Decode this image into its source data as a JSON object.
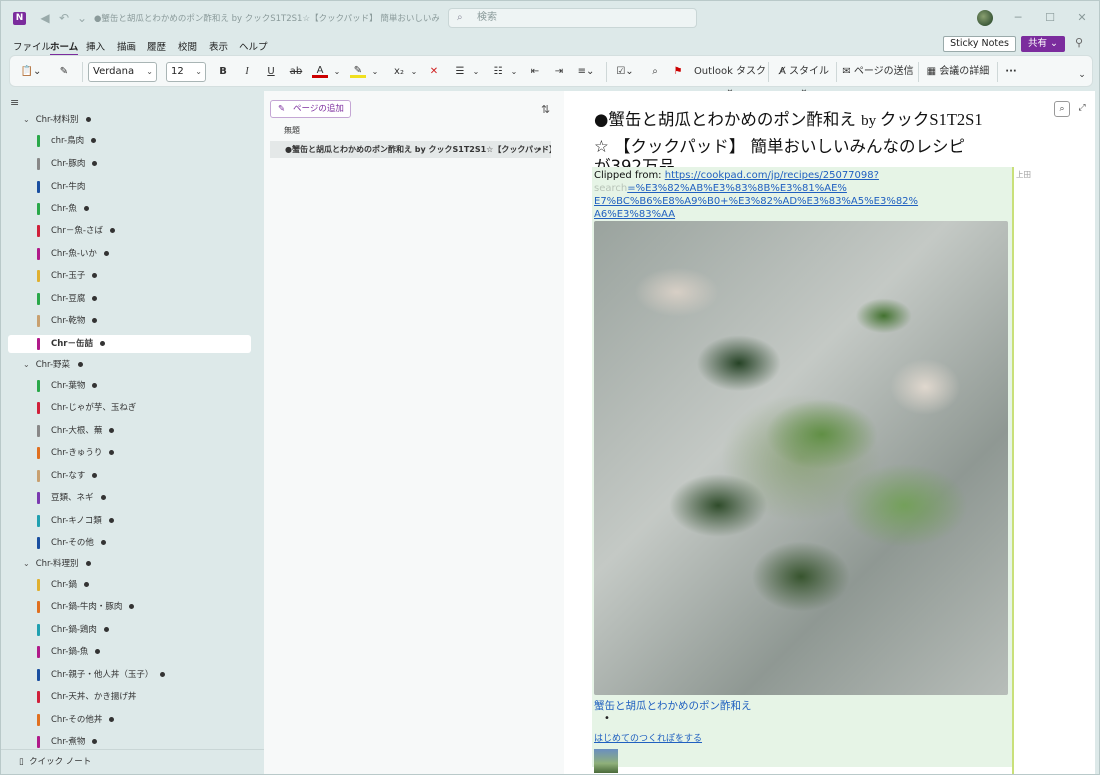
{
  "window": {
    "title": "●蟹缶と胡瓜とわかめのポン酢和え by クックS1T2S1☆【クックパッド】 簡単おいしいみんなの - One...",
    "search_placeholder": "検索"
  },
  "menu": [
    "ファイル",
    "ホーム",
    "挿入",
    "描画",
    "履歴",
    "校閲",
    "表示",
    "ヘルプ"
  ],
  "active_menu": "ホーム",
  "top_right": {
    "sticky_notes": "Sticky Notes",
    "share": "共有"
  },
  "ribbon": {
    "font": "Verdana",
    "size": "12",
    "bold": "B",
    "italic": "I",
    "underline": "U",
    "strike": "ab",
    "font_color": "A",
    "subscript": "x₂",
    "outlook_tasks": "Outlook タスク",
    "styles": "スタイル",
    "send_page": "ページの送信",
    "meeting": "会議の詳細",
    "more": "···"
  },
  "sidebar": {
    "sections": [
      {
        "label": "Chr-材料別"
      },
      {
        "label": "Chr-野菜"
      },
      {
        "label": "Chr-料理別"
      }
    ],
    "pages": [
      {
        "label": "chr-鳥肉",
        "color": "#2aa84a",
        "dot": true
      },
      {
        "label": "Chr-豚肉",
        "color": "#888888",
        "dot": true
      },
      {
        "label": "Chr-牛肉",
        "color": "#1a4fa0",
        "dot": false
      },
      {
        "label": "Chr-魚",
        "color": "#2aa84a",
        "dot": true
      },
      {
        "label": "Chr－魚-さば",
        "color": "#d0203a",
        "dot": true
      },
      {
        "label": "Chr-魚-いか",
        "color": "#b01a8a",
        "dot": true
      },
      {
        "label": "Chr-玉子",
        "color": "#e0b030",
        "dot": true
      },
      {
        "label": "Chr-豆腐",
        "color": "#2aa84a",
        "dot": true
      },
      {
        "label": "Chr-乾物",
        "color": "#c8a070",
        "dot": true
      },
      {
        "label": "Chr－缶詰",
        "color": "#b01a8a",
        "dot": true
      },
      {
        "label": "Chr-葉物",
        "color": "#2aa84a",
        "dot": true
      },
      {
        "label": "Chr-じゃが芋、玉ねぎ",
        "color": "#d0203a",
        "dot": false
      },
      {
        "label": "Chr-大根、蕪",
        "color": "#888888",
        "dot": true
      },
      {
        "label": "Chr-きゅうり",
        "color": "#e07020",
        "dot": true
      },
      {
        "label": "Chr-なす",
        "color": "#c8a070",
        "dot": true
      },
      {
        "label": "豆類、ネギ",
        "color": "#7a3ab0",
        "dot": true
      },
      {
        "label": "Chr-キノコ類",
        "color": "#20a0b0",
        "dot": true
      },
      {
        "label": "Chr-その他",
        "color": "#1a4fa0",
        "dot": true
      },
      {
        "label": "Chr-鍋",
        "color": "#e0b030",
        "dot": true
      },
      {
        "label": "Chr-鍋-牛肉・豚肉",
        "color": "#e07020",
        "dot": true
      },
      {
        "label": "Chr-鍋-鶏肉",
        "color": "#20a0b0",
        "dot": true
      },
      {
        "label": "Chr-鍋-魚",
        "color": "#b01a8a",
        "dot": true
      },
      {
        "label": "Chr-親子・他人丼（玉子）",
        "color": "#1a4fa0",
        "dot": true
      },
      {
        "label": "Chr-天丼、かき揚げ丼",
        "color": "#d0203a",
        "dot": false
      },
      {
        "label": "Chr-その他丼",
        "color": "#e07020",
        "dot": true
      },
      {
        "label": "Chr-煮物",
        "color": "#b01a8a",
        "dot": true
      }
    ],
    "selected": "Chr－缶詰",
    "quick_note": "クイック ノート"
  },
  "pages_pane": {
    "add_page": "ページの追加",
    "items": [
      {
        "label": "無題"
      },
      {
        "label": "●蟹缶と胡瓜とわかめのポン酢和え by クックS1T2S1☆【クックパッド】..."
      }
    ]
  },
  "content": {
    "title_a": "●蟹缶と胡瓜とわかめのポン酢和え ",
    "title_by": "by ",
    "title_b": "クック",
    "title_en": "S1T2S1",
    "title_line2": "☆ 【クックパッド】 簡単おいしいみんなのレシピ",
    "title_line3": "が392万品",
    "author": "上田",
    "clipped_label": "Clipped from: ",
    "url_a": "https://cookpad.com/jp/recipes/25077098?",
    "url_b": "=%E3%82%AB%E3%83%8B%E3%81%AE%",
    "url_c": "E7%BC%B6%E8%A9%B0+%E3%82%AD%E3%83%A5%E3%82%",
    "url_d": "A6%E3%83%AA",
    "url_prefix": "search",
    "dish_title": "蟹缶と胡瓜とわかめのポン酢和え",
    "first_report": "はじめてのつくれぽをする"
  }
}
